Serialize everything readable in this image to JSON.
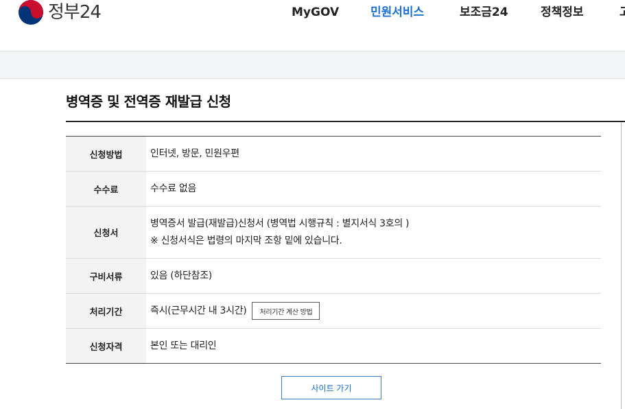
{
  "header": {
    "logo_text": "정부24",
    "nav": [
      "MyGOV",
      "민원서비스",
      "보조금24",
      "정책정보",
      "고"
    ],
    "active_index": 1,
    "colors": {
      "active": "#1a6fd1",
      "logo_red": "#c8102e",
      "logo_blue": "#003478"
    }
  },
  "page": {
    "title": "병역증 및 전역증 재발급 신청"
  },
  "table": {
    "rows": [
      {
        "label": "신청방법",
        "lines": [
          "인터넷, 방문, 민원우편"
        ]
      },
      {
        "label": "수수료",
        "lines": [
          "수수료 없음"
        ]
      },
      {
        "label": "신청서",
        "lines": [
          "병역증서 발급(재발급)신청서 (병역법 시행규칙 : 별지서식 3호의 )",
          "※ 신청서식은 법령의 마지막 조항 밑에 있습니다."
        ]
      },
      {
        "label": "구비서류",
        "lines": [
          "있음 (하단참조)"
        ]
      },
      {
        "label": "처리기간",
        "lines": [
          "즉시(근무시간 내 3시간)"
        ],
        "button": "처리기간 계산 방법"
      },
      {
        "label": "신청자격",
        "lines": [
          "본인 또는 대리인"
        ]
      }
    ]
  },
  "site_button": "사이트 가기"
}
